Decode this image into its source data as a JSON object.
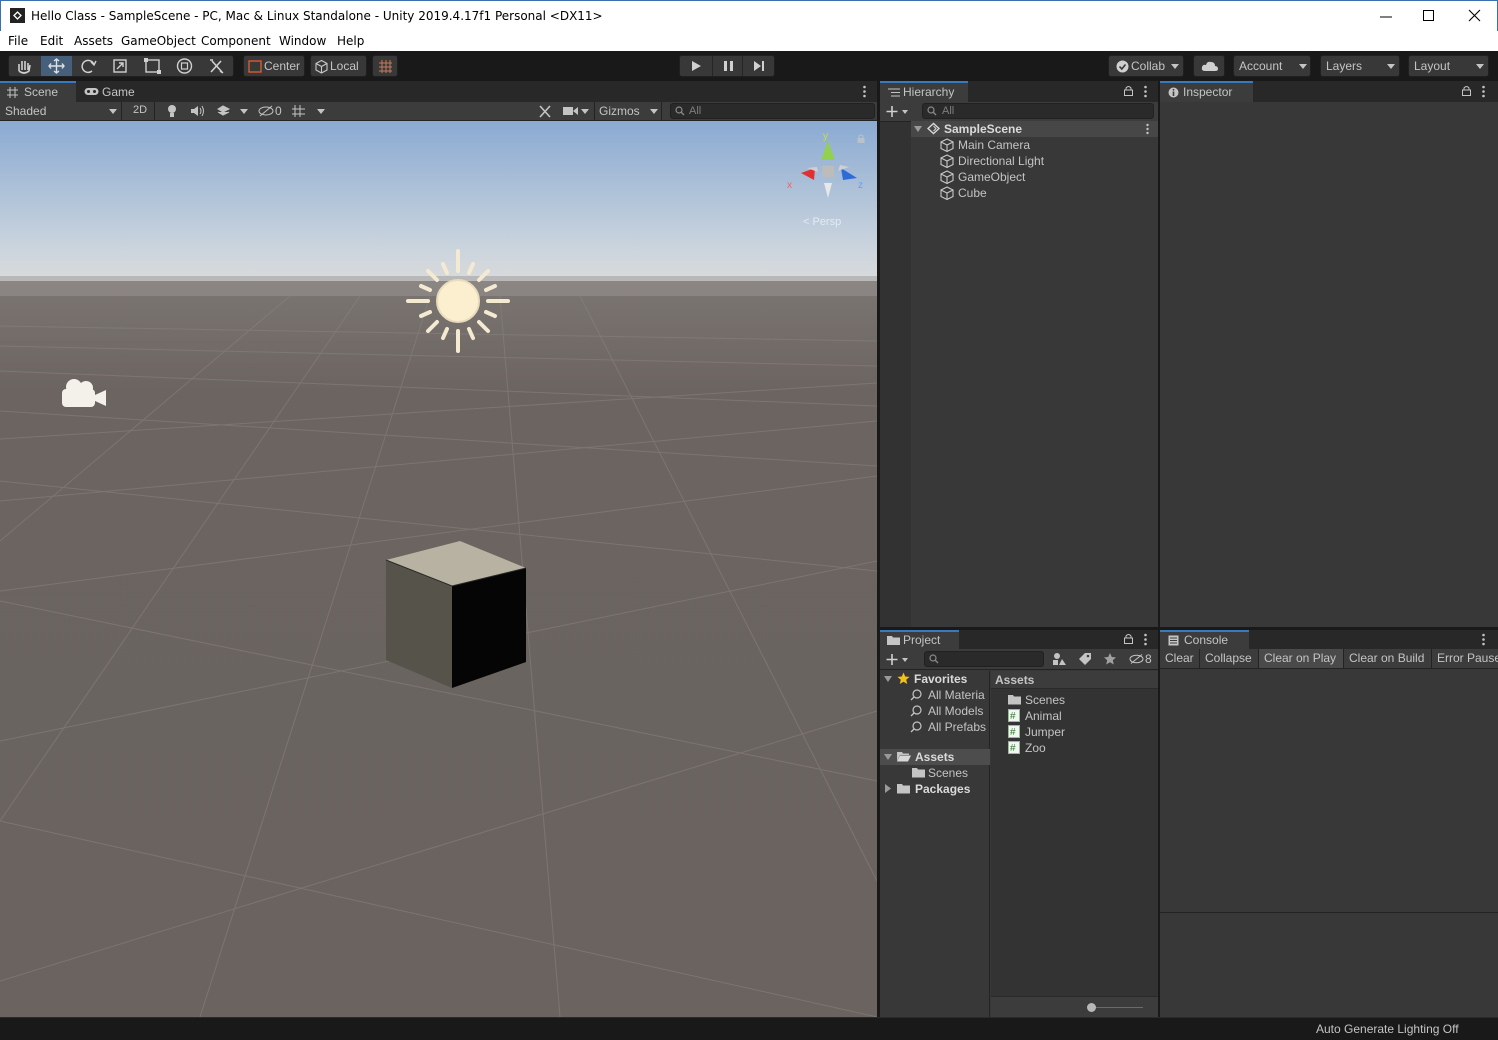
{
  "window": {
    "title": "Hello Class - SampleScene - PC, Mac & Linux Standalone - Unity 2019.4.17f1 Personal <DX11>"
  },
  "menu": [
    "File",
    "Edit",
    "Assets",
    "GameObject",
    "Component",
    "Window",
    "Help"
  ],
  "toolbar": {
    "tools": [
      "hand-tool",
      "move-tool",
      "rotate-tool",
      "scale-tool",
      "rect-tool",
      "transform-tool",
      "custom-tool"
    ],
    "active_tool": "move-tool",
    "pivot_label": "Center",
    "space_label": "Local",
    "collab_label": "Collab",
    "account_label": "Account",
    "layers_label": "Layers",
    "layout_label": "Layout"
  },
  "scene_view": {
    "tabs": [
      "Scene",
      "Game"
    ],
    "active_tab": "Scene",
    "shading_mode": "Shaded",
    "mode_2d": "2D",
    "hidden_count": "0",
    "gizmos_label": "Gizmos",
    "search_placeholder": "All",
    "gizmo_axes": {
      "x": "x",
      "y": "y",
      "z": "z",
      "persp": "< Persp"
    }
  },
  "hierarchy": {
    "title": "Hierarchy",
    "search_placeholder": "All",
    "scene_name": "SampleScene",
    "items": [
      "Main Camera",
      "Directional Light",
      "GameObject",
      "Cube"
    ]
  },
  "inspector": {
    "title": "Inspector"
  },
  "project": {
    "title": "Project",
    "hidden_count": "8",
    "favorites_label": "Favorites",
    "favorites": [
      "All Materia",
      "All Models",
      "All Prefabs"
    ],
    "assets_label": "Assets",
    "assets_children": [
      "Scenes"
    ],
    "packages_label": "Packages",
    "breadcrumb": "Assets",
    "files": [
      {
        "name": "Scenes",
        "icon": "folder-icon"
      },
      {
        "name": "Animal",
        "icon": "script-icon"
      },
      {
        "name": "Jumper",
        "icon": "script-icon"
      },
      {
        "name": "Zoo",
        "icon": "script-icon"
      }
    ]
  },
  "console": {
    "title": "Console",
    "buttons": [
      "Clear",
      "Collapse",
      "Clear on Play",
      "Clear on Build",
      "Error Pause"
    ],
    "active_buttons": [
      "Clear on Play"
    ]
  },
  "status_bar": {
    "text": "Auto Generate Lighting Off"
  },
  "colors": {
    "accent": "#3a79bb",
    "panel": "#383838",
    "dark": "#191919",
    "sky": "#9fb8d8",
    "ground": "#6a6460"
  }
}
